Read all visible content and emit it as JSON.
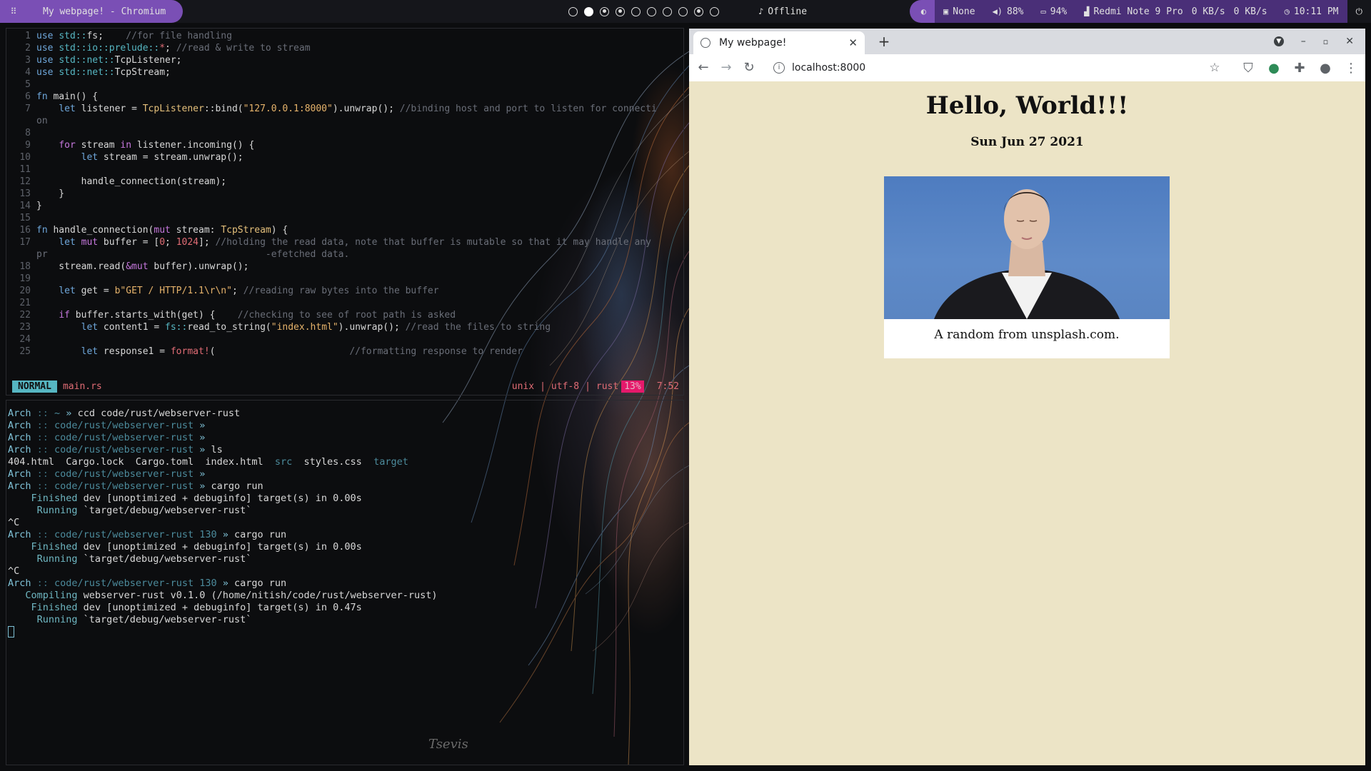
{
  "topbar": {
    "window_title": "My webpage! - Chromium",
    "net_status": "Offline",
    "theme_label": "None",
    "volume": "88%",
    "battery": "94%",
    "wifi_name": "Redmi Note 9 Pro",
    "net_down": "0 KB/s",
    "net_up": "0 KB/s",
    "clock": "10:11 PM",
    "workspaces": [
      "empty",
      "active",
      "occupied",
      "occupied",
      "empty",
      "empty",
      "empty",
      "empty",
      "occupied",
      "empty"
    ]
  },
  "editor": {
    "mode": "NORMAL",
    "filename": "main.rs",
    "fileformat": "unix",
    "encoding": "utf-8",
    "filetype": "rust",
    "percent": "13%",
    "position": "7:52",
    "lines": [
      {
        "n": "1",
        "html": "<span class=\"kw2\">use</span> <span class=\"path\">std::</span>fs;    <span class=\"cm\">//for file handling</span>"
      },
      {
        "n": "2",
        "html": "<span class=\"kw2\">use</span> <span class=\"path\">std::io::prelude::</span><span class=\"nm\">*</span>; <span class=\"cm\">//read &amp; write to stream</span>"
      },
      {
        "n": "3",
        "html": "<span class=\"kw2\">use</span> <span class=\"path\">std::net::</span>TcpListener;"
      },
      {
        "n": "4",
        "html": "<span class=\"kw2\">use</span> <span class=\"path\">std::net::</span>TcpStream;"
      },
      {
        "n": "5",
        "html": ""
      },
      {
        "n": "6",
        "html": "<span class=\"kw2\">fn</span> main() {"
      },
      {
        "n": "7",
        "html": "    <span class=\"kw2\">let</span> listener = <span class=\"ty\">TcpListener</span>::bind(<span class=\"st\">\"127.0.0.1:8000\"</span>).unwrap(); <span class=\"cm\">//binding host and port to listen for connecti</span>"
      },
      {
        "n": "",
        "html": "<span class=\"cm\">on</span>"
      },
      {
        "n": "8",
        "html": ""
      },
      {
        "n": "9",
        "html": "    <span class=\"kw\">for</span> stream <span class=\"kw\">in</span> listener.incoming() {"
      },
      {
        "n": "10",
        "html": "        <span class=\"kw2\">let</span> stream = stream.unwrap();"
      },
      {
        "n": "11",
        "html": ""
      },
      {
        "n": "12",
        "html": "        handle_connection(stream);"
      },
      {
        "n": "13",
        "html": "    }"
      },
      {
        "n": "14",
        "html": "}"
      },
      {
        "n": "15",
        "html": ""
      },
      {
        "n": "16",
        "html": "<span class=\"kw2\">fn</span> handle_connection(<span class=\"kw\">mut</span> stream: <span class=\"ty\">TcpStream</span>) {"
      },
      {
        "n": "17",
        "html": "    <span class=\"kw2\">let</span> <span class=\"kw\">mut</span> buffer = [<span class=\"nm\">0</span>; <span class=\"nm\">1024</span>]; <span class=\"cm\">//holding the read data, note that buffer is mutable so that it may handle any</span>"
      },
      {
        "n": "",
        "html": "<span class=\"cm\">pr                                       -efetched data.</span>"
      },
      {
        "n": "18",
        "html": "    stream.read(<span class=\"kw\">&amp;mut</span> buffer).unwrap();"
      },
      {
        "n": "19",
        "html": ""
      },
      {
        "n": "20",
        "html": "    <span class=\"kw2\">let</span> get = <span class=\"st\">b\"GET / HTTP/1.1\\r\\n\"</span>; <span class=\"cm\">//reading raw bytes into the buffer</span>"
      },
      {
        "n": "21",
        "html": ""
      },
      {
        "n": "22",
        "html": "    <span class=\"kw\">if</span> buffer.starts_with(get) {    <span class=\"cm\">//checking to see of root path is asked</span>"
      },
      {
        "n": "23",
        "html": "        <span class=\"kw2\">let</span> content1 = <span class=\"path\">fs::</span>read_to_string(<span class=\"st\">\"index.html\"</span>).unwrap(); <span class=\"cm\">//read the files to string</span>"
      },
      {
        "n": "24",
        "html": ""
      },
      {
        "n": "25",
        "html": "        <span class=\"kw2\">let</span> response1 = <span class=\"mac\">format!</span>(                        <span class=\"cm\">//formatting response to render</span>"
      }
    ]
  },
  "shell": {
    "lines": [
      {
        "host": "Arch",
        "dir": "~",
        "code": "",
        "cmd": "ccd code/rust/webserver-rust"
      },
      {
        "host": "Arch",
        "dir": "code/rust/webserver-rust",
        "code": "",
        "cmd": ""
      },
      {
        "host": "Arch",
        "dir": "code/rust/webserver-rust",
        "code": "",
        "cmd": ""
      },
      {
        "host": "Arch",
        "dir": "code/rust/webserver-rust",
        "code": "",
        "cmd": "ls"
      },
      {
        "out": "404.html  Cargo.lock  Cargo.toml  index.html  <span class=\"dir\">src</span>  styles.css  <span class=\"dir\">target</span>"
      },
      {
        "host": "Arch",
        "dir": "code/rust/webserver-rust",
        "code": "",
        "cmd": ""
      },
      {
        "host": "Arch",
        "dir": "code/rust/webserver-rust",
        "code": "",
        "cmd": "cargo run"
      },
      {
        "out": "    <span class=\"green\">Finished</span> dev [unoptimized + debuginfo] target(s) in 0.00s"
      },
      {
        "out": "     <span class=\"green\">Running</span> `target/debug/webserver-rust`"
      },
      {
        "out": "^C"
      },
      {
        "host": "Arch",
        "dir": "code/rust/webserver-rust",
        "code": "130",
        "cmd": "cargo run"
      },
      {
        "out": "    <span class=\"green\">Finished</span> dev [unoptimized + debuginfo] target(s) in 0.00s"
      },
      {
        "out": "     <span class=\"green\">Running</span> `target/debug/webserver-rust`"
      },
      {
        "out": "^C"
      },
      {
        "host": "Arch",
        "dir": "code/rust/webserver-rust",
        "code": "130",
        "cmd": "cargo run"
      },
      {
        "out": "   <span class=\"green\">Compiling</span> webserver-rust v0.1.0 (/home/nitish/code/rust/webserver-rust)"
      },
      {
        "out": "    <span class=\"green\">Finished</span> dev [unoptimized + debuginfo] target(s) in 0.47s"
      },
      {
        "out": "     <span class=\"green\">Running</span> `target/debug/webserver-rust`"
      },
      {
        "cursor": true
      }
    ],
    "signature": "Tsevis"
  },
  "browser": {
    "tab_title": "My webpage!",
    "new_tab": "+",
    "url": "localhost:8000",
    "page": {
      "heading": "Hello, World!!!",
      "date": "Sun Jun 27 2021",
      "caption": "A random from unsplash.com."
    }
  }
}
